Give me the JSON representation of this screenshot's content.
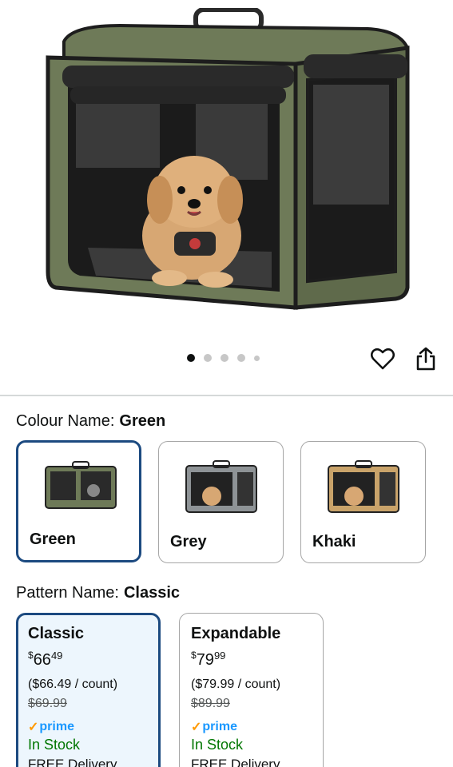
{
  "carousel": {
    "count": 5,
    "active_index": 0
  },
  "actions": {
    "favorite_icon": "heart-outline-icon",
    "share_icon": "share-icon"
  },
  "colour": {
    "label": "Colour Name:",
    "selected": "Green",
    "options": [
      {
        "name": "Green",
        "body": "#6e7a58",
        "selected": true
      },
      {
        "name": "Grey",
        "body": "#8e9396",
        "selected": false
      },
      {
        "name": "Khaki",
        "body": "#c9a36a",
        "selected": false
      }
    ]
  },
  "pattern": {
    "label": "Pattern Name:",
    "selected": "Classic",
    "options": [
      {
        "name": "Classic",
        "currency": "$",
        "price_whole": "66",
        "price_cents": "49",
        "unit_price": "($66.49 / count)",
        "list_price": "$69.99",
        "prime": "prime",
        "stock": "In Stock",
        "delivery": "FREE Delivery",
        "selected": true
      },
      {
        "name": "Expandable",
        "currency": "$",
        "price_whole": "79",
        "price_cents": "99",
        "unit_price": "($79.99 / count)",
        "list_price": "$89.99",
        "prime": "prime",
        "stock": "In Stock",
        "delivery": "FREE Delivery",
        "selected": false
      }
    ]
  },
  "colors": {
    "selected_border": "#1c4a80",
    "selected_bg": "#edf6fd",
    "in_stock": "#007600",
    "prime_blue": "#1a98ff",
    "prime_check": "#ff9900"
  }
}
